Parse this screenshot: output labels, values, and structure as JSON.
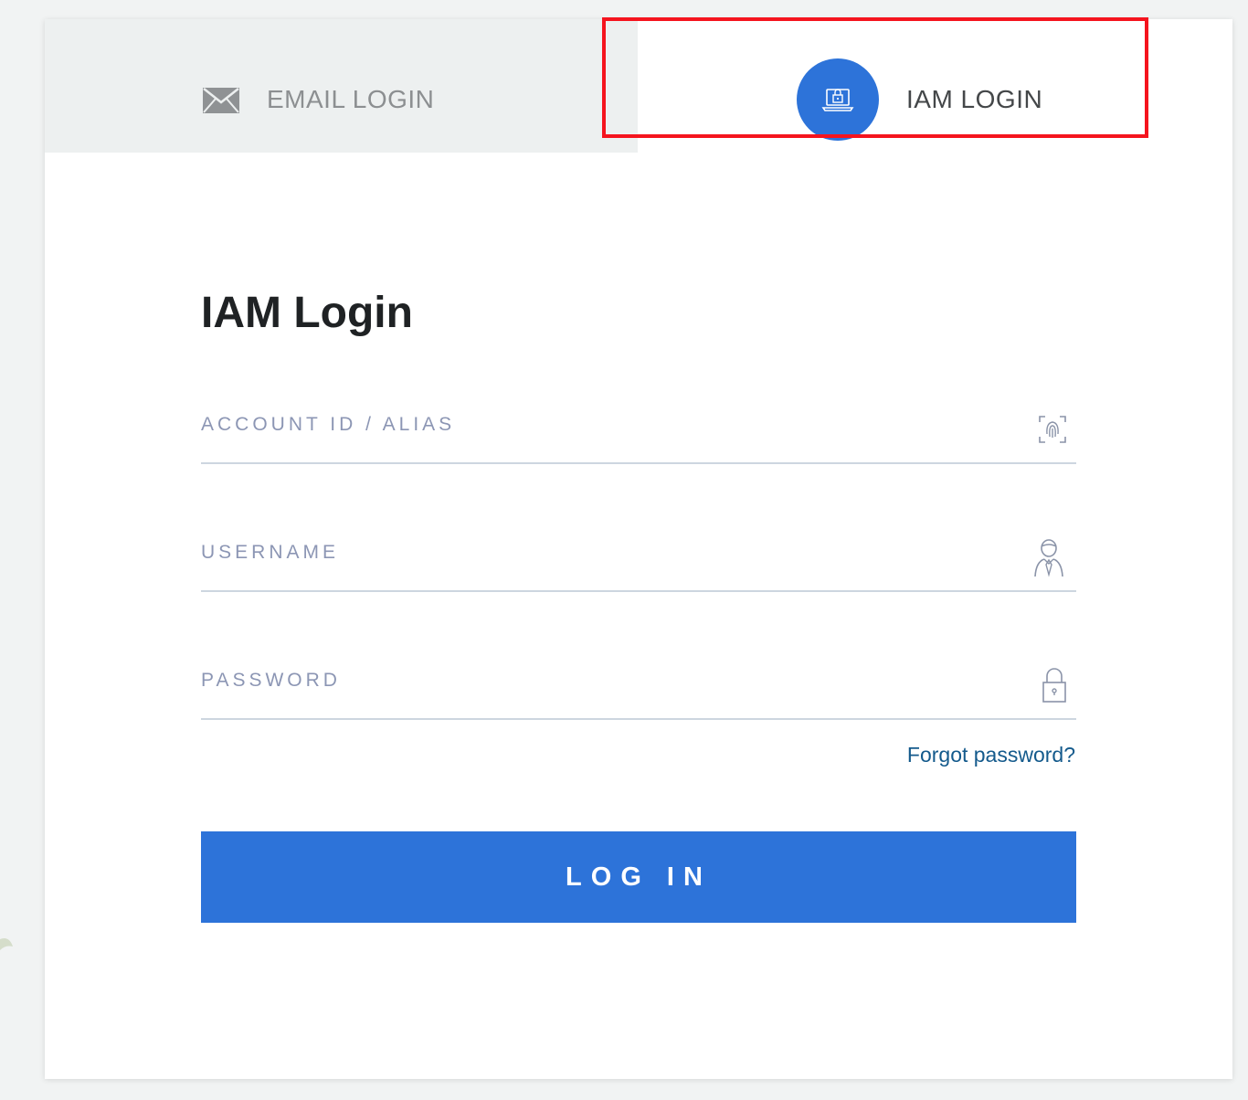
{
  "tabs": {
    "email": {
      "label": "EMAIL LOGIN",
      "icon": "envelope-icon"
    },
    "iam": {
      "label": "IAM LOGIN",
      "icon": "laptop-lock-icon",
      "active": true
    }
  },
  "form": {
    "title": "IAM Login",
    "fields": {
      "account": {
        "placeholder": "ACCOUNT ID / ALIAS",
        "value": "",
        "icon": "fingerprint-icon"
      },
      "username": {
        "placeholder": "USERNAME",
        "value": "",
        "icon": "user-icon"
      },
      "password": {
        "placeholder": "PASSWORD",
        "value": "",
        "icon": "lock-icon"
      }
    },
    "forgot_label": "Forgot password?",
    "submit_label": "LOG IN"
  },
  "colors": {
    "accent": "#2d73d9",
    "highlight": "#f5141e",
    "link": "#145a8c",
    "inactive_tab_bg": "#edf0f0"
  }
}
